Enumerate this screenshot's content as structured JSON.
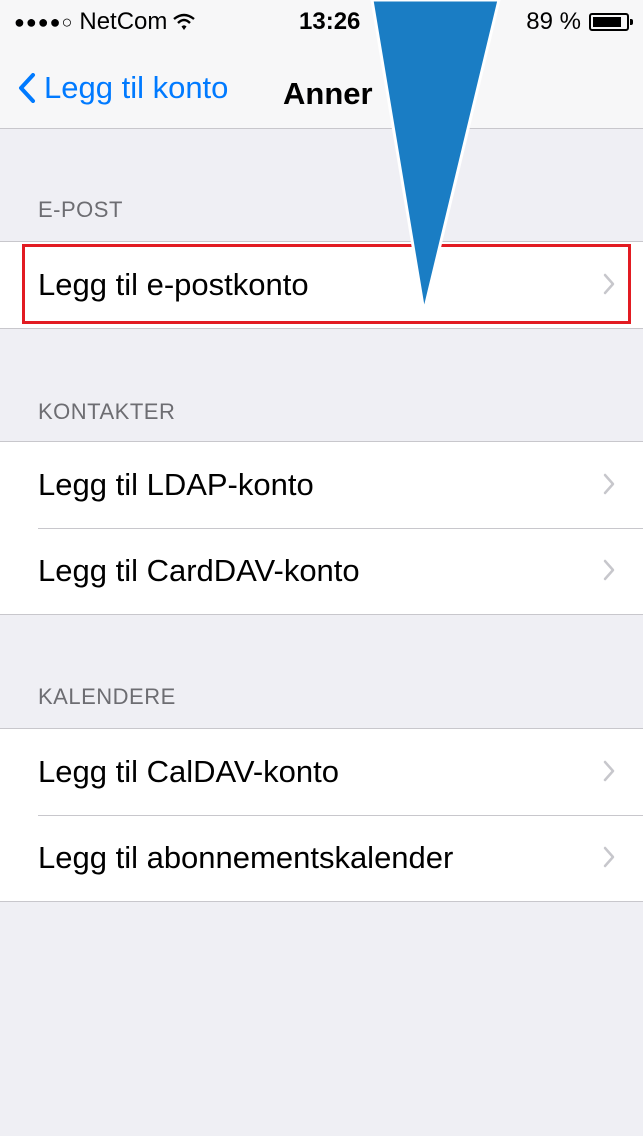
{
  "status_bar": {
    "carrier": "NetCom",
    "time": "13:26",
    "battery_percent": "89 %",
    "battery_level": 0.89
  },
  "nav": {
    "back_label": "Legg til konto",
    "title": "Anner"
  },
  "sections": [
    {
      "header": "E-POST",
      "items": [
        {
          "label": "Legg til e-postkonto"
        }
      ]
    },
    {
      "header": "KONTAKTER",
      "items": [
        {
          "label": "Legg til LDAP-konto"
        },
        {
          "label": "Legg til CardDAV-konto"
        }
      ]
    },
    {
      "header": "KALENDERE",
      "items": [
        {
          "label": "Legg til CalDAV-konto"
        },
        {
          "label": "Legg til abonnementskalender"
        }
      ]
    }
  ],
  "colors": {
    "accent": "#007aff",
    "highlight_border": "#e21b22",
    "pointer_arrow": "#1a7dc4"
  },
  "icons": [
    "signal-dots-icon",
    "wifi-icon",
    "battery-icon",
    "back-chevron-icon",
    "chevron-right-icon",
    "pointer-arrow-icon"
  ]
}
